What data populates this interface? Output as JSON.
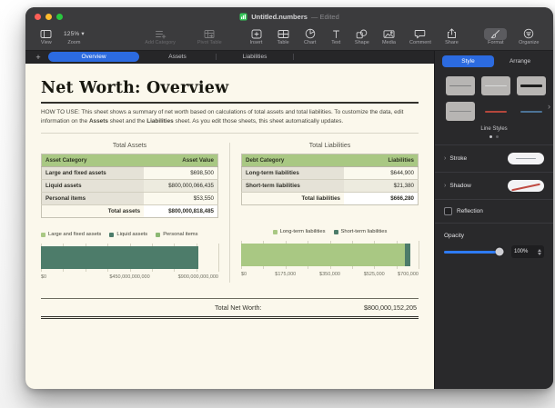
{
  "titlebar": {
    "doc_title": "Untitled.numbers",
    "edited": "— Edited"
  },
  "toolbar": {
    "view": "View",
    "zoom": "Zoom",
    "zoom_value": "125% ▾",
    "add_category": "Add Category",
    "pivot_table": "Pivot Table",
    "insert": "Insert",
    "table": "Table",
    "chart": "Chart",
    "text": "Text",
    "shape": "Shape",
    "media": "Media",
    "comment": "Comment",
    "share": "Share",
    "format": "Format",
    "organize": "Organize"
  },
  "sheet_tabs": {
    "add": "+",
    "tabs": [
      "Overview",
      "Assets",
      "Liabilities"
    ],
    "active": "Overview"
  },
  "document": {
    "heading": "Net Worth: Overview",
    "howto": {
      "prefix": "HOW TO USE: This sheet shows a summary of net worth based on calculations of total assets and total liabilities. To customize the data, edit information on the ",
      "bold1": "Assets",
      "middle": " sheet and the ",
      "bold2": "Liabilities",
      "suffix": " sheet. As you edit those sheets, this sheet automatically updates."
    },
    "assets_table": {
      "title": "Total Assets",
      "headers": [
        "Asset Category",
        "Asset Value"
      ],
      "rows": [
        [
          "Large and fixed assets",
          "$698,500"
        ],
        [
          "Liquid assets",
          "$800,000,066,435"
        ],
        [
          "Personal items",
          "$53,550"
        ]
      ],
      "footer_label": "Total assets",
      "footer_value": "$800,000,818,485"
    },
    "liabilities_table": {
      "title": "Total Liabilities",
      "headers": [
        "Debt Category",
        "Liabilities"
      ],
      "rows": [
        [
          "Long-term liabilities",
          "$644,900"
        ],
        [
          "Short-term liabilities",
          "$21,380"
        ]
      ],
      "footer_label": "Total liabilities",
      "footer_value": "$666,280"
    },
    "net_worth_label": "Total Net Worth:",
    "net_worth_value": "$800,000,152,205"
  },
  "chart_data": [
    {
      "type": "bar",
      "orientation": "horizontal",
      "stacked": true,
      "title": "Total Assets",
      "grid": true,
      "legend_position": "top",
      "series": [
        {
          "name": "Large and fixed assets",
          "value": 698500,
          "color": "#a9c883"
        },
        {
          "name": "Liquid assets",
          "value": 800000066435,
          "color": "#4d7c6a"
        },
        {
          "name": "Personal items",
          "value": 53550,
          "color": "#8bb873"
        }
      ],
      "xlim": [
        0,
        900000000000
      ],
      "tick_labels": [
        "$0",
        "$450,000,000,000",
        "$900,000,000,000"
      ]
    },
    {
      "type": "bar",
      "orientation": "horizontal",
      "stacked": true,
      "title": "Total Liabilities",
      "grid": true,
      "legend_position": "top",
      "series": [
        {
          "name": "Long-term liabilities",
          "value": 644900,
          "color": "#a9c883"
        },
        {
          "name": "Short-term liabilities",
          "value": 21380,
          "color": "#4d7c6a"
        }
      ],
      "xlim": [
        0,
        700000
      ],
      "tick_labels": [
        "$0",
        "$175,000",
        "$350,000",
        "$525,000",
        "$700,000"
      ]
    }
  ],
  "sidebar": {
    "tabs": [
      "Style",
      "Arrange"
    ],
    "active_tab": "Style",
    "line_styles_caption": "Line Styles",
    "stroke_label": "Stroke",
    "shadow_label": "Shadow",
    "reflection_label": "Reflection",
    "opacity_label": "Opacity",
    "opacity_value": "100%"
  },
  "colors": {
    "accent_blue": "#2c6be0",
    "table_header_green": "#a9c883",
    "bar_dark_teal": "#4d7c6a",
    "bar_light_green": "#a9c883",
    "canvas_cream": "#fbf8ec"
  }
}
